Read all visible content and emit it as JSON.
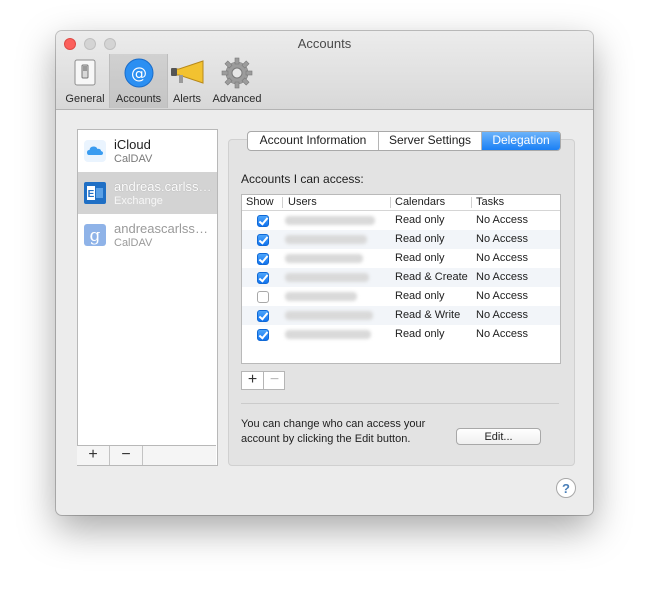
{
  "window": {
    "title": "Accounts"
  },
  "toolbar": {
    "items": [
      {
        "label": "General",
        "icon": "general-switch-icon"
      },
      {
        "label": "Accounts",
        "icon": "at-sign-icon",
        "selected": true
      },
      {
        "label": "Alerts",
        "icon": "megaphone-icon"
      },
      {
        "label": "Advanced",
        "icon": "gear-icon"
      }
    ]
  },
  "accounts": [
    {
      "name": "iCloud",
      "type": "CalDAV",
      "icon": "icloud-icon"
    },
    {
      "name": "andreas.carlsson@...",
      "type": "Exchange",
      "icon": "exchange-icon",
      "selected": true
    },
    {
      "name": "andreascarlsson...",
      "type": "CalDAV",
      "icon": "google-icon"
    }
  ],
  "sidebar_buttons": {
    "add": "+",
    "remove": "−"
  },
  "tabs": [
    "Account Information",
    "Server Settings",
    "Delegation"
  ],
  "active_tab": "Delegation",
  "delegation": {
    "accounts_label": "Accounts I can access:",
    "columns": {
      "show": "Show",
      "users": "Users",
      "calendars": "Calendars",
      "tasks": "Tasks"
    },
    "rows": [
      {
        "show": true,
        "calendars": "Read only",
        "tasks": "No Access"
      },
      {
        "show": true,
        "calendars": "Read only",
        "tasks": "No Access"
      },
      {
        "show": true,
        "calendars": "Read only",
        "tasks": "No Access"
      },
      {
        "show": true,
        "calendars": "Read & Create",
        "tasks": "No Access"
      },
      {
        "show": false,
        "calendars": "Read only",
        "tasks": "No Access"
      },
      {
        "show": true,
        "calendars": "Read & Write",
        "tasks": "No Access"
      },
      {
        "show": true,
        "calendars": "Read only",
        "tasks": "No Access"
      }
    ],
    "add_label": "+",
    "remove_label": "−",
    "note": "You can change who can access your account by clicking the Edit button.",
    "edit_label": "Edit..."
  },
  "help_label": "?",
  "colors": {
    "accent": "#1b80f5",
    "close": "#fc605c"
  }
}
